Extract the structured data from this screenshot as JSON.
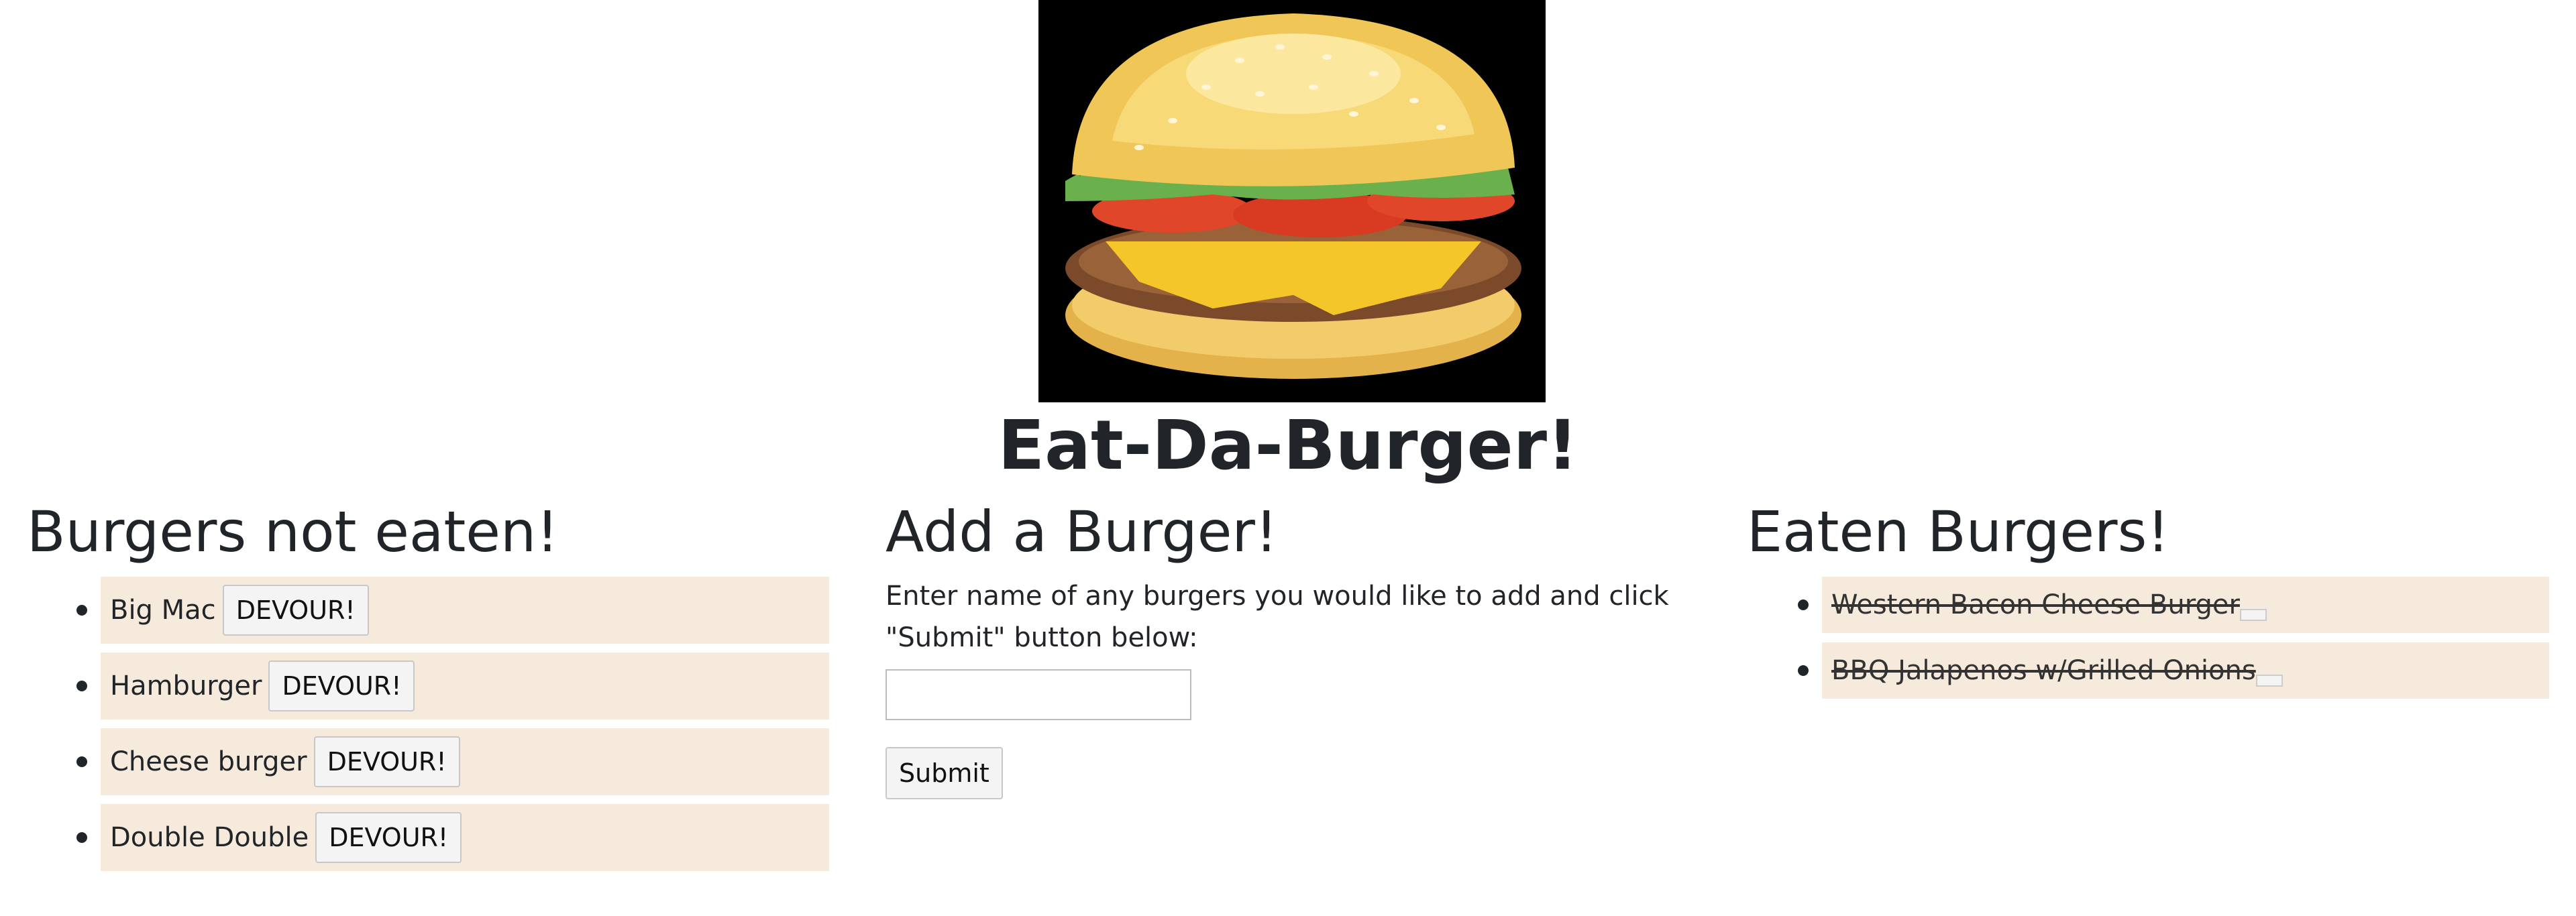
{
  "header": {
    "title": "Eat-Da-Burger!",
    "image_icon": "burger-image"
  },
  "not_eaten": {
    "heading": "Burgers not eaten!",
    "button_label": "DEVOUR!",
    "items": [
      {
        "name": "Big Mac"
      },
      {
        "name": "Hamburger"
      },
      {
        "name": "Cheese burger"
      },
      {
        "name": "Double Double"
      }
    ]
  },
  "add": {
    "heading": "Add a Burger!",
    "instructions": "Enter name of any burgers you would like to add and click \"Submit\" button below:",
    "input_value": "",
    "submit_label": "Submit"
  },
  "eaten": {
    "heading": "Eaten Burgers!",
    "items": [
      {
        "name": "Western Bacon Cheese Burger"
      },
      {
        "name": "BBQ Jalapenos w/Grilled Onions"
      }
    ]
  },
  "colors": {
    "list_bg": "#f5eadb",
    "text": "#212529"
  }
}
